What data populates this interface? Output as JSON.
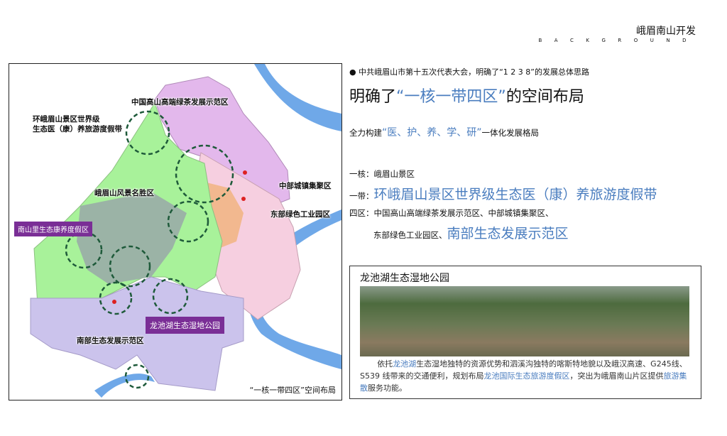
{
  "header": {
    "title": "峨眉南山开发",
    "subtitle": "BACKGROUND"
  },
  "map": {
    "labels": {
      "tea": "中国高山高端绿茶发展示范区",
      "belt_1": "环峨眉山景区世界级",
      "belt_2": "生态医（康）养旅游度假带",
      "scenic": "峨眉山风景名胜区",
      "central": "中部城镇集聚区",
      "east": "东部绿色工业园区",
      "south": "南部生态发展示范区"
    },
    "callouts": {
      "nanshanli": "南山里生态康养度假区",
      "longchi": "龙池湖生态湿地公园"
    },
    "caption": "“一核一带四区”空间布局"
  },
  "right": {
    "bullet": "中共峨眉山市第十五次代表大会，明确了“1 2 3 8”的发展总体思路",
    "headline": {
      "pre": "明确了",
      "highlight": "“一核一带四区”",
      "post": "的空间布局"
    },
    "line2": {
      "pre": "全力构建",
      "highlight": "“医、护、养、学、研”",
      "post": "一体化发展格局"
    },
    "core": {
      "label": "一核：",
      "text": "峨眉山景区"
    },
    "belt": {
      "label": "一带：",
      "text": "环峨眉山景区世界级生态医（康）养旅游度假带"
    },
    "zones": {
      "label": "四区：",
      "text1": "中国高山高端绿茶发展示范区、中部城镇集聚区、",
      "text2": "东部绿色工业园区、",
      "highlight": "南部生态发展示范区"
    }
  },
  "card": {
    "title": "龙池湖生态湿地公园",
    "desc": [
      {
        "t": "依托"
      },
      {
        "t": "龙池湖",
        "h": true
      },
      {
        "t": "生态湿地独特的资源优势和泗溪沟独特的喀斯特地貌以及峨汉高速、G245线、S539 线带来的交通便利，规划布局"
      },
      {
        "t": "龙池国际生态旅游度假区",
        "h": true
      },
      {
        "t": "，突出为峨眉南山片区提供"
      },
      {
        "t": "旅游集散",
        "h": true
      },
      {
        "t": "服务功能。"
      }
    ]
  },
  "colors": {
    "accent": "#4a7dbf",
    "callout": "#7a2e96"
  }
}
